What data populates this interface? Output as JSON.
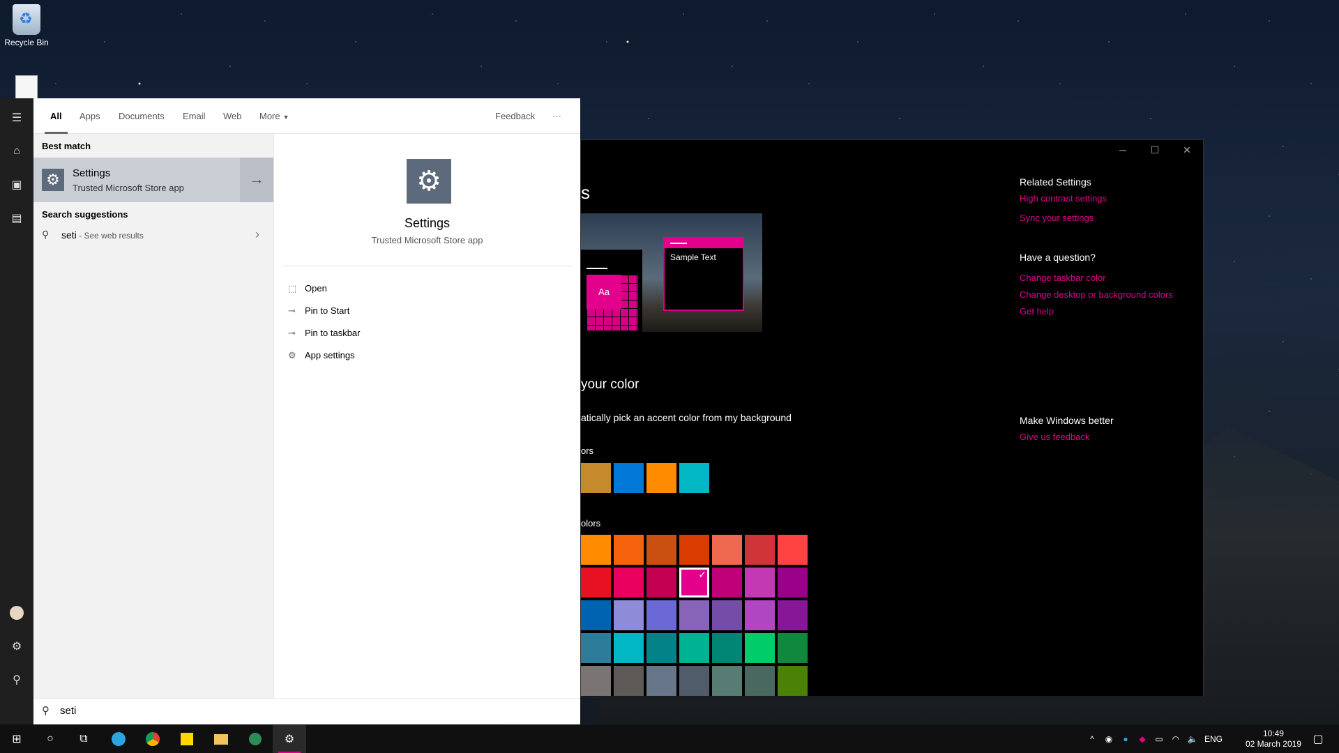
{
  "desktop": {
    "recycle_bin_label": "Recycle Bin"
  },
  "settings_window": {
    "title_fragment": "s",
    "preview_tile_text": "Aa",
    "preview_sample_text": "Sample Text",
    "section_heading": "your color",
    "auto_pick_text": "atically pick an accent color from my background",
    "recent_colors_label": "ors",
    "windows_colors_label": "olors",
    "recent_colors": [
      "#c58a2c",
      "#0078d7",
      "#ff8c00",
      "#00b7c3"
    ],
    "windows_colors": [
      [
        "#ff8c00",
        "#f7630c",
        "#ca5010",
        "#da3b01",
        "#ef6950",
        "#d13438",
        "#ff4343"
      ],
      [
        "#e81123",
        "#ea005e",
        "#c30052",
        "#e3008c",
        "#bf0077",
        "#c239b3",
        "#9a0089"
      ],
      [
        "#0063b1",
        "#8e8cd8",
        "#6b69d6",
        "#8764b8",
        "#744da9",
        "#b146c2",
        "#881798"
      ],
      [
        "#2d7d9a",
        "#00b7c3",
        "#038387",
        "#00b294",
        "#018574",
        "#00cc6a",
        "#10893e"
      ],
      [
        "#7a7574",
        "#5d5a58",
        "#68768a",
        "#515c6b",
        "#567c73",
        "#486860",
        "#498205"
      ]
    ],
    "selected_color": "#e3008c",
    "accent_color": "#e3008c",
    "related_settings_heading": "Related Settings",
    "related_links": [
      "High contrast settings",
      "Sync your settings"
    ],
    "question_heading": "Have a question?",
    "question_links": [
      "Change taskbar color",
      "Change desktop or background colors",
      "Get help"
    ],
    "better_heading": "Make Windows better",
    "better_links": [
      "Give us feedback"
    ]
  },
  "search": {
    "tabs": [
      "All",
      "Apps",
      "Documents",
      "Email",
      "Web",
      "More"
    ],
    "feedback_label": "Feedback",
    "overflow_label": "···",
    "best_match_label": "Best match",
    "result_title": "Settings",
    "result_subtitle": "Trusted Microsoft Store app",
    "suggestions_label": "Search suggestions",
    "suggestion_query": "seti",
    "suggestion_hint": " - See web results",
    "detail_title": "Settings",
    "detail_subtitle": "Trusted Microsoft Store app",
    "actions": [
      "Open",
      "Pin to Start",
      "Pin to taskbar",
      "App settings"
    ],
    "query": "seti"
  },
  "taskbar": {
    "language": "ENG",
    "time": "10:49",
    "date": "02 March 2019"
  }
}
